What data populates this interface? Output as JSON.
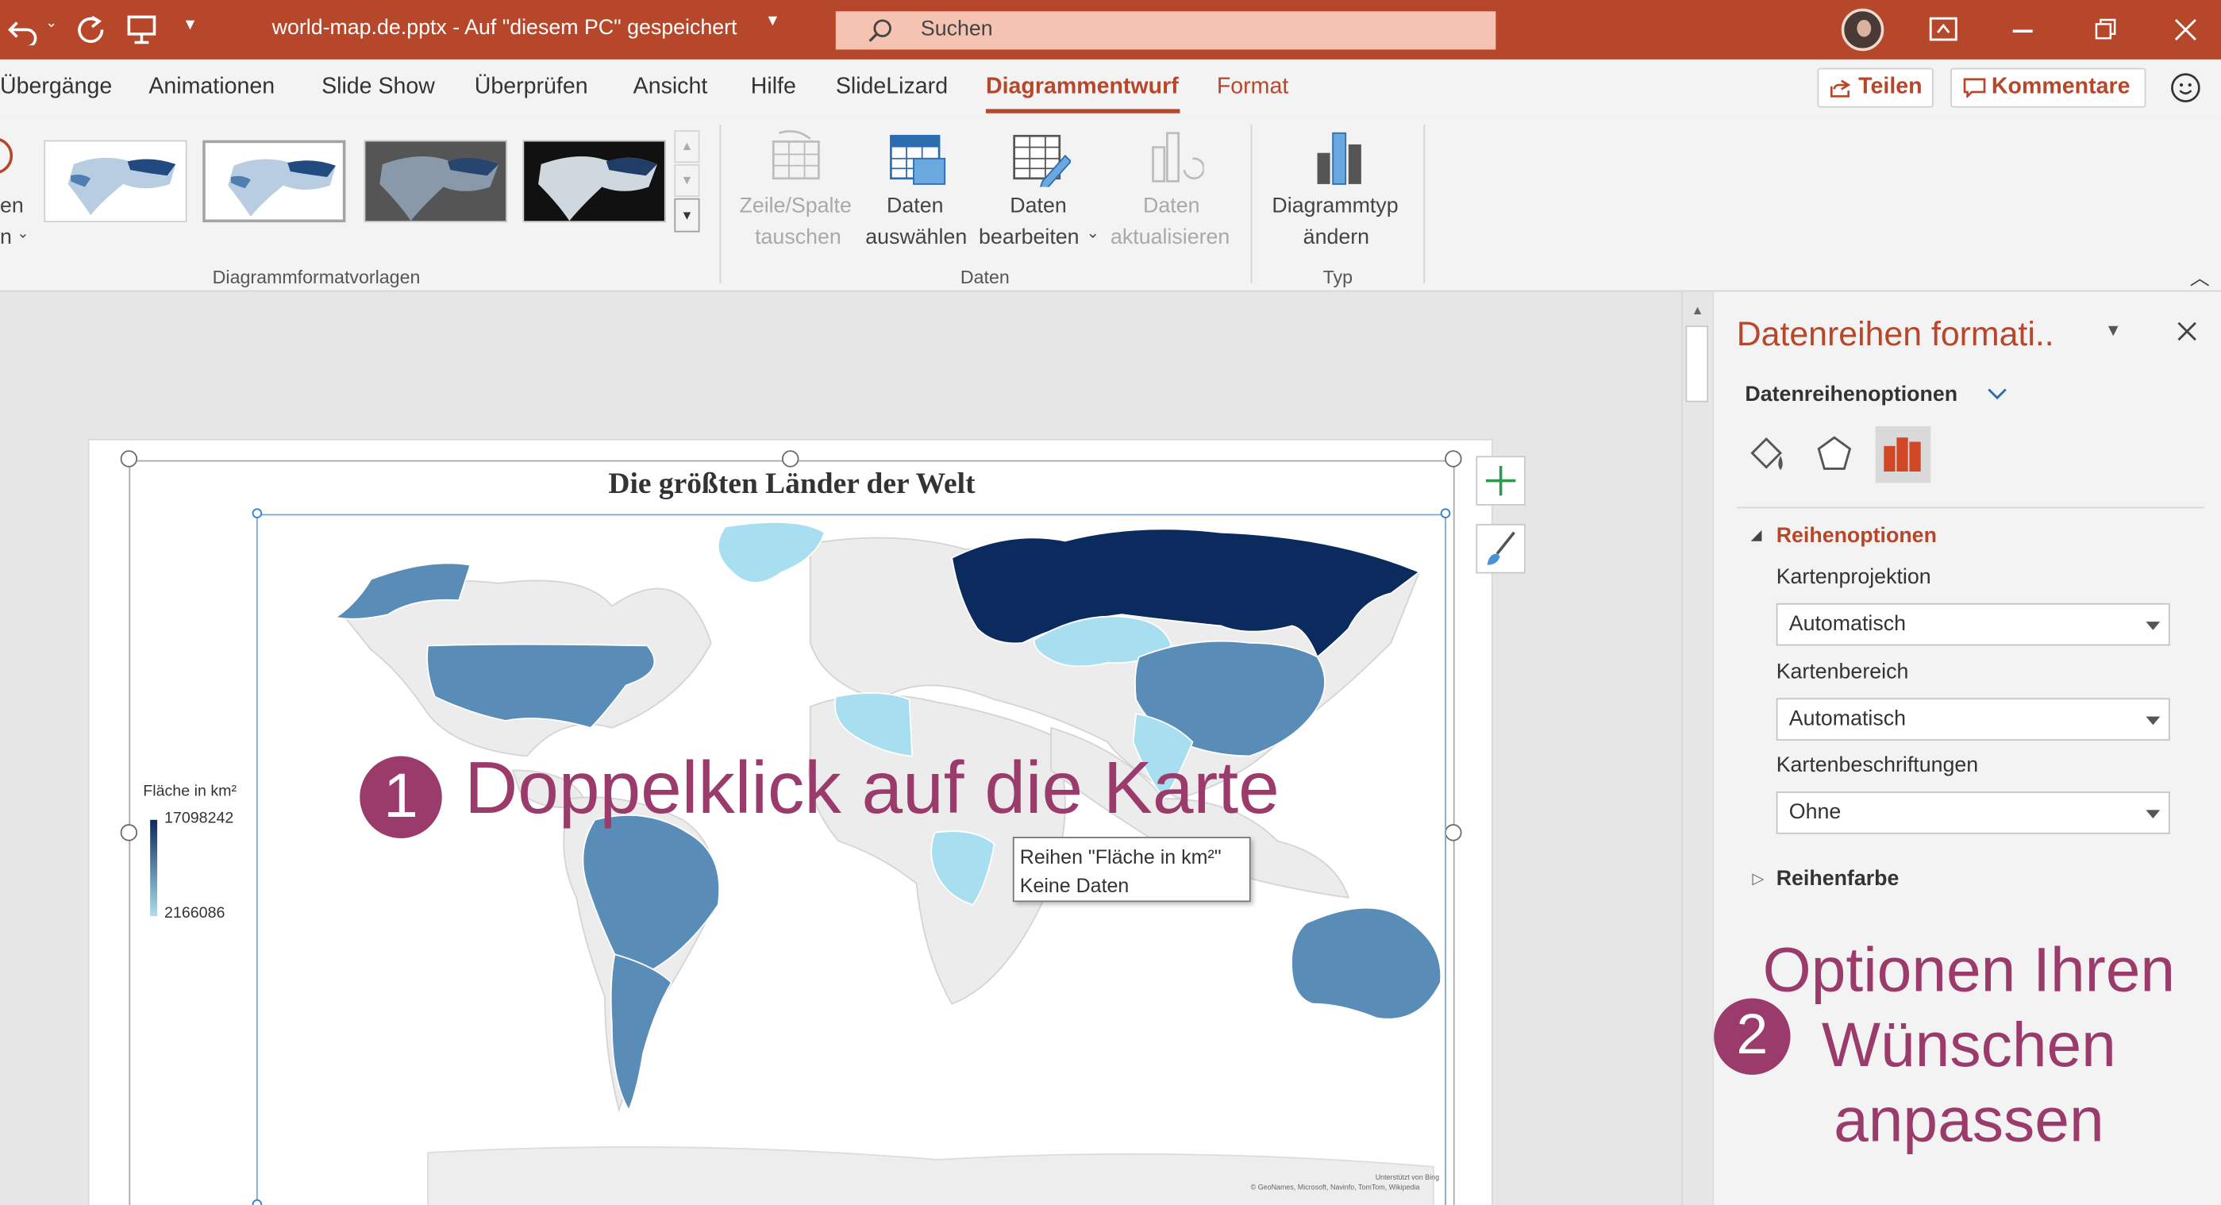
{
  "titlebar": {
    "doc_title": "world-map.de.pptx  -  Auf \"diesem PC\" gespeichert",
    "search_placeholder": "Suchen"
  },
  "tabs": [
    "Übergänge",
    "Animationen",
    "Slide Show",
    "Überprüfen",
    "Ansicht",
    "Hilfe",
    "SlideLizard",
    "Diagrammentwurf",
    "Format"
  ],
  "active_tab": "Diagrammentwurf",
  "header_buttons": {
    "share": "Teilen",
    "comments": "Kommentare"
  },
  "ribbon": {
    "left_partial": {
      "line1": "en",
      "line2": "n"
    },
    "styles_group": "Diagrammformatvorlagen",
    "data_group": "Daten",
    "type_group": "Typ",
    "buttons": {
      "switch_row_col": {
        "l1": "Zeile/Spalte",
        "l2": "tauschen"
      },
      "select_data": {
        "l1": "Daten",
        "l2": "auswählen"
      },
      "edit_data": {
        "l1": "Daten",
        "l2": "bearbeiten"
      },
      "refresh_data": {
        "l1": "Daten",
        "l2": "aktualisieren"
      },
      "change_type": {
        "l1": "Diagrammtyp",
        "l2": "ändern"
      }
    }
  },
  "chart": {
    "title": "Die größten Länder der Welt",
    "legend_title": "Fläche in  km²",
    "legend_max": "17098242",
    "legend_min": "2166086",
    "tooltip_line1": "Reihen \"Fläche in  km²\"",
    "tooltip_line2": "Keine Daten",
    "attribution1": "Unterstützt von Bing",
    "attribution2": "© GeoNames, Microsoft, Navinfo, TomTom, Wikipedia"
  },
  "annotations": {
    "step1_num": "1",
    "step1_text": "Doppelklick auf die Karte",
    "step2_num": "2",
    "step2_l1": "Optionen Ihren",
    "step2_l2": "Wünschen",
    "step2_l3": "anpassen"
  },
  "pane": {
    "title": "Datenreihen formati..",
    "subtitle": "Datenreihenoptionen",
    "section": "Reihenoptionen",
    "projection_label": "Kartenprojektion",
    "projection_value": "Automatisch",
    "area_label": "Kartenbereich",
    "area_value": "Automatisch",
    "labels_label": "Kartenbeschriftungen",
    "labels_value": "Ohne",
    "color_section": "Reihenfarbe"
  },
  "colors": {
    "accent": "#b7472a",
    "annotation": "#9b3b6b",
    "russia": "#0b2a5e",
    "mid": "#5a8cb8",
    "light": "#a8dff0"
  }
}
